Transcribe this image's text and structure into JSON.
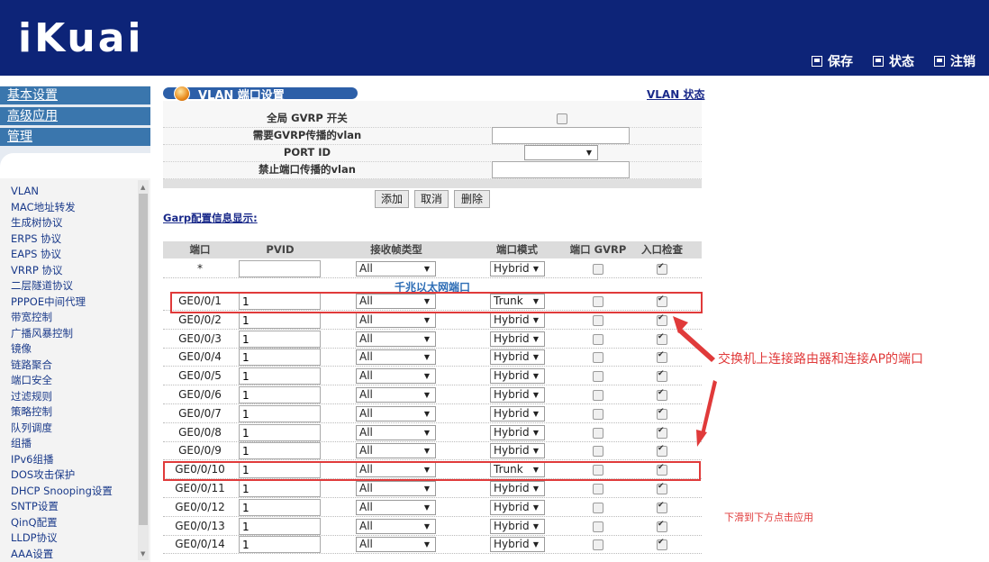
{
  "header": {
    "logo": "iKuai",
    "links": [
      "保存",
      "状态",
      "注销"
    ]
  },
  "nav": {
    "sections": [
      "基本设置",
      "高级应用",
      "管理"
    ],
    "items": [
      "VLAN",
      "MAC地址转发",
      "生成树协议",
      "ERPS 协议",
      "EAPS 协议",
      "VRRP 协议",
      "二层隧道协议",
      "PPPOE中间代理",
      "带宽控制",
      "广播风暴控制",
      "镜像",
      "链路聚合",
      "端口安全",
      "过滤规则",
      "策略控制",
      "队列调度",
      "组播",
      "IPv6组播",
      "DOS攻击保护",
      "DHCP Snooping设置",
      "SNTP设置",
      "QinQ配置",
      "LLDP协议",
      "AAA设置"
    ]
  },
  "page": {
    "title": "VLAN 端口设置",
    "status_link": "VLAN 状态",
    "global_gvrp_label": "全局 GVRP 开关",
    "gvrp_vlan_label": "需要GVRP传播的vlan",
    "port_id_label": "PORT ID",
    "forbid_vlan_label": "禁止端口传播的vlan",
    "add_button": "添加",
    "cancel_button": "取消",
    "delete_button": "删除",
    "garp_link": "Garp配置信息显示:"
  },
  "table": {
    "headers": [
      "端口",
      "PVID",
      "接收帧类型",
      "端口模式",
      "端口 GVRP",
      "入口检查"
    ],
    "section_title": "千兆以太网端口",
    "default_row": {
      "port": "*",
      "pvid": "",
      "frame": "All",
      "mode": "Hybrid",
      "gvrp": false,
      "check": true
    },
    "rows": [
      {
        "port": "GE0/0/1",
        "pvid": "1",
        "frame": "All",
        "mode": "Trunk",
        "gvrp": false,
        "check": true
      },
      {
        "port": "GE0/0/2",
        "pvid": "1",
        "frame": "All",
        "mode": "Hybrid",
        "gvrp": false,
        "check": true
      },
      {
        "port": "GE0/0/3",
        "pvid": "1",
        "frame": "All",
        "mode": "Hybrid",
        "gvrp": false,
        "check": true
      },
      {
        "port": "GE0/0/4",
        "pvid": "1",
        "frame": "All",
        "mode": "Hybrid",
        "gvrp": false,
        "check": true
      },
      {
        "port": "GE0/0/5",
        "pvid": "1",
        "frame": "All",
        "mode": "Hybrid",
        "gvrp": false,
        "check": true
      },
      {
        "port": "GE0/0/6",
        "pvid": "1",
        "frame": "All",
        "mode": "Hybrid",
        "gvrp": false,
        "check": true
      },
      {
        "port": "GE0/0/7",
        "pvid": "1",
        "frame": "All",
        "mode": "Hybrid",
        "gvrp": false,
        "check": true
      },
      {
        "port": "GE0/0/8",
        "pvid": "1",
        "frame": "All",
        "mode": "Hybrid",
        "gvrp": false,
        "check": true
      },
      {
        "port": "GE0/0/9",
        "pvid": "1",
        "frame": "All",
        "mode": "Hybrid",
        "gvrp": false,
        "check": true
      },
      {
        "port": "GE0/0/10",
        "pvid": "1",
        "frame": "All",
        "mode": "Trunk",
        "gvrp": false,
        "check": true
      },
      {
        "port": "GE0/0/11",
        "pvid": "1",
        "frame": "All",
        "mode": "Hybrid",
        "gvrp": false,
        "check": true
      },
      {
        "port": "GE0/0/12",
        "pvid": "1",
        "frame": "All",
        "mode": "Hybrid",
        "gvrp": false,
        "check": true
      },
      {
        "port": "GE0/0/13",
        "pvid": "1",
        "frame": "All",
        "mode": "Hybrid",
        "gvrp": false,
        "check": true
      },
      {
        "port": "GE0/0/14",
        "pvid": "1",
        "frame": "All",
        "mode": "Hybrid",
        "gvrp": false,
        "check": true
      }
    ]
  },
  "annotations": {
    "main_note": "交换机上连接路由器和连接AP的端口",
    "scroll_hint": "下滑到下方点击应用",
    "color": "#e03a3a"
  },
  "colors": {
    "header_bg": "#0d2478",
    "nav_bg": "#3a76ad",
    "section_title": "#2d6db5"
  }
}
